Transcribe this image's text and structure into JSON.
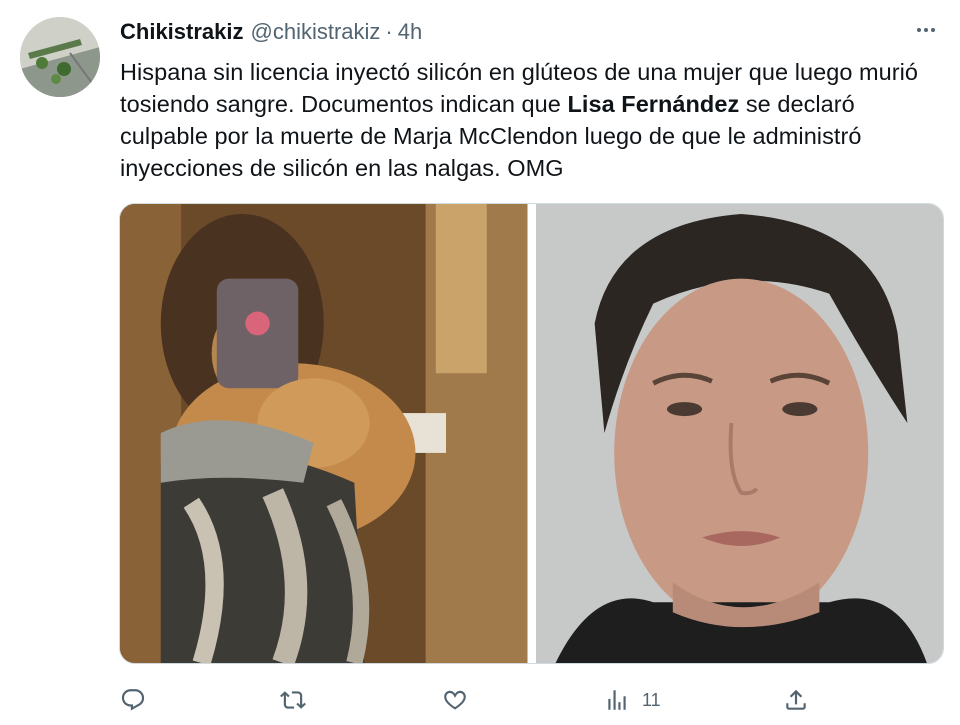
{
  "tweet": {
    "display_name": "Chikistrakiz",
    "handle": "@chikistrakiz",
    "separator": "·",
    "time": "4h",
    "text": {
      "part1": "Hispana sin licencia inyectó silicón en glúteos de una mujer que luego murió tosiendo sangre. Documentos indican que ",
      "bold": "Lisa Fernández",
      "part2": " se declaró culpable por la muerte de Marja McClendon luego de que le administró inyecciones de silicón en las nalgas. OMG"
    },
    "icons": {
      "more": "more-horizontal-icon",
      "reply": "reply-bubble-icon",
      "retweet": "retweet-arrows-icon",
      "like": "heart-icon",
      "views": "bar-chart-icon",
      "share": "share-upload-icon"
    },
    "views_count": "11"
  },
  "colors": {
    "text_primary": "#0f1419",
    "text_secondary": "#536471",
    "border": "#cfd9de"
  }
}
